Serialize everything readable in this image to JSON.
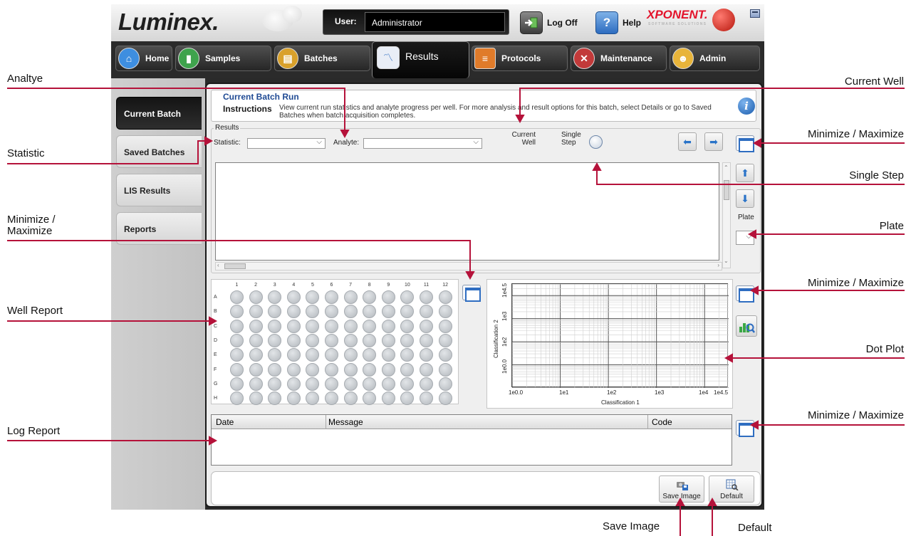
{
  "app": {
    "logo": "Luminex.",
    "user_label": "User:",
    "user_value": "Administrator",
    "logoff_label": "Log Off",
    "help_label": "Help",
    "brand": "XPONENT.",
    "brand_sub": "SOFTWARE SOLUTIONS"
  },
  "nav": {
    "tabs": [
      {
        "label": "Home",
        "icon": "home-icon",
        "color": "#3e8ee0"
      },
      {
        "label": "Samples",
        "icon": "samples-icon",
        "color": "#3fa34d"
      },
      {
        "label": "Batches",
        "icon": "batches-icon",
        "color": "#d9a12b"
      },
      {
        "label": "Results",
        "icon": "results-icon",
        "color": "#4e86c8"
      },
      {
        "label": "Protocols",
        "icon": "protocols-icon",
        "color": "#e07b2a"
      },
      {
        "label": "Maintenance",
        "icon": "maintenance-icon",
        "color": "#c23a3a"
      },
      {
        "label": "Admin",
        "icon": "admin-icon",
        "color": "#e8b43a"
      }
    ],
    "active": "Results"
  },
  "sidebar": {
    "items": [
      {
        "label": "Current Batch",
        "active": true
      },
      {
        "label": "Saved Batches",
        "active": false
      },
      {
        "label": "LIS Results",
        "active": false
      },
      {
        "label": "Reports",
        "active": false
      }
    ]
  },
  "main": {
    "title": "Current Batch Run",
    "instructions_title": "Instructions",
    "instructions_text": "View current run statistics and analyte progress per well. For more analysis and result options for this batch, select Details or go to Saved Batches when batch acquisition completes.",
    "results_legend": "Results",
    "statistic_label": "Statistic:",
    "statistic_value": "",
    "analyte_label": "Analyte:",
    "analyte_value": "",
    "current_well_label": "Current\nWell",
    "single_step_label": "Single\nStep",
    "plate_label": "Plate",
    "plate_value": ""
  },
  "plate": {
    "columns": [
      "1",
      "2",
      "3",
      "4",
      "5",
      "6",
      "7",
      "8",
      "9",
      "10",
      "11",
      "12"
    ],
    "rows": [
      "A",
      "B",
      "C",
      "D",
      "E",
      "F",
      "G",
      "H"
    ]
  },
  "dot_plot": {
    "x_label": "Classification 1",
    "y_label": "Classification 2",
    "x_ticks": [
      "1e0.0",
      "1e1",
      "1e2",
      "1e3",
      "1e4",
      "1e4.5"
    ],
    "y_ticks": [
      "1e0.0",
      "1e2",
      "1e3",
      "1e4.5"
    ]
  },
  "log": {
    "columns": [
      "Date",
      "Message",
      "Code"
    ]
  },
  "footer": {
    "save_image_label": "Save Image",
    "default_label": "Default"
  },
  "callouts": {
    "analyte": "Analtye",
    "statistic": "Statistic",
    "minimize_maximize_left": "Minimize /\nMaximize",
    "well_report": "Well Report",
    "log_report": "Log Report",
    "current_well": "Current Well",
    "minimize_maximize_1": "Minimize / Maximize",
    "single_step": "Single Step",
    "plate": "Plate",
    "minimize_maximize_2": "Minimize / Maximize",
    "dot_plot": "Dot Plot",
    "minimize_maximize_3": "Minimize / Maximize",
    "save_image": "Save Image",
    "default": "Default"
  },
  "colors": {
    "callout_line": "#b5123a",
    "title_blue": "#1f4a94",
    "accent_blue": "#2e6dc1"
  }
}
